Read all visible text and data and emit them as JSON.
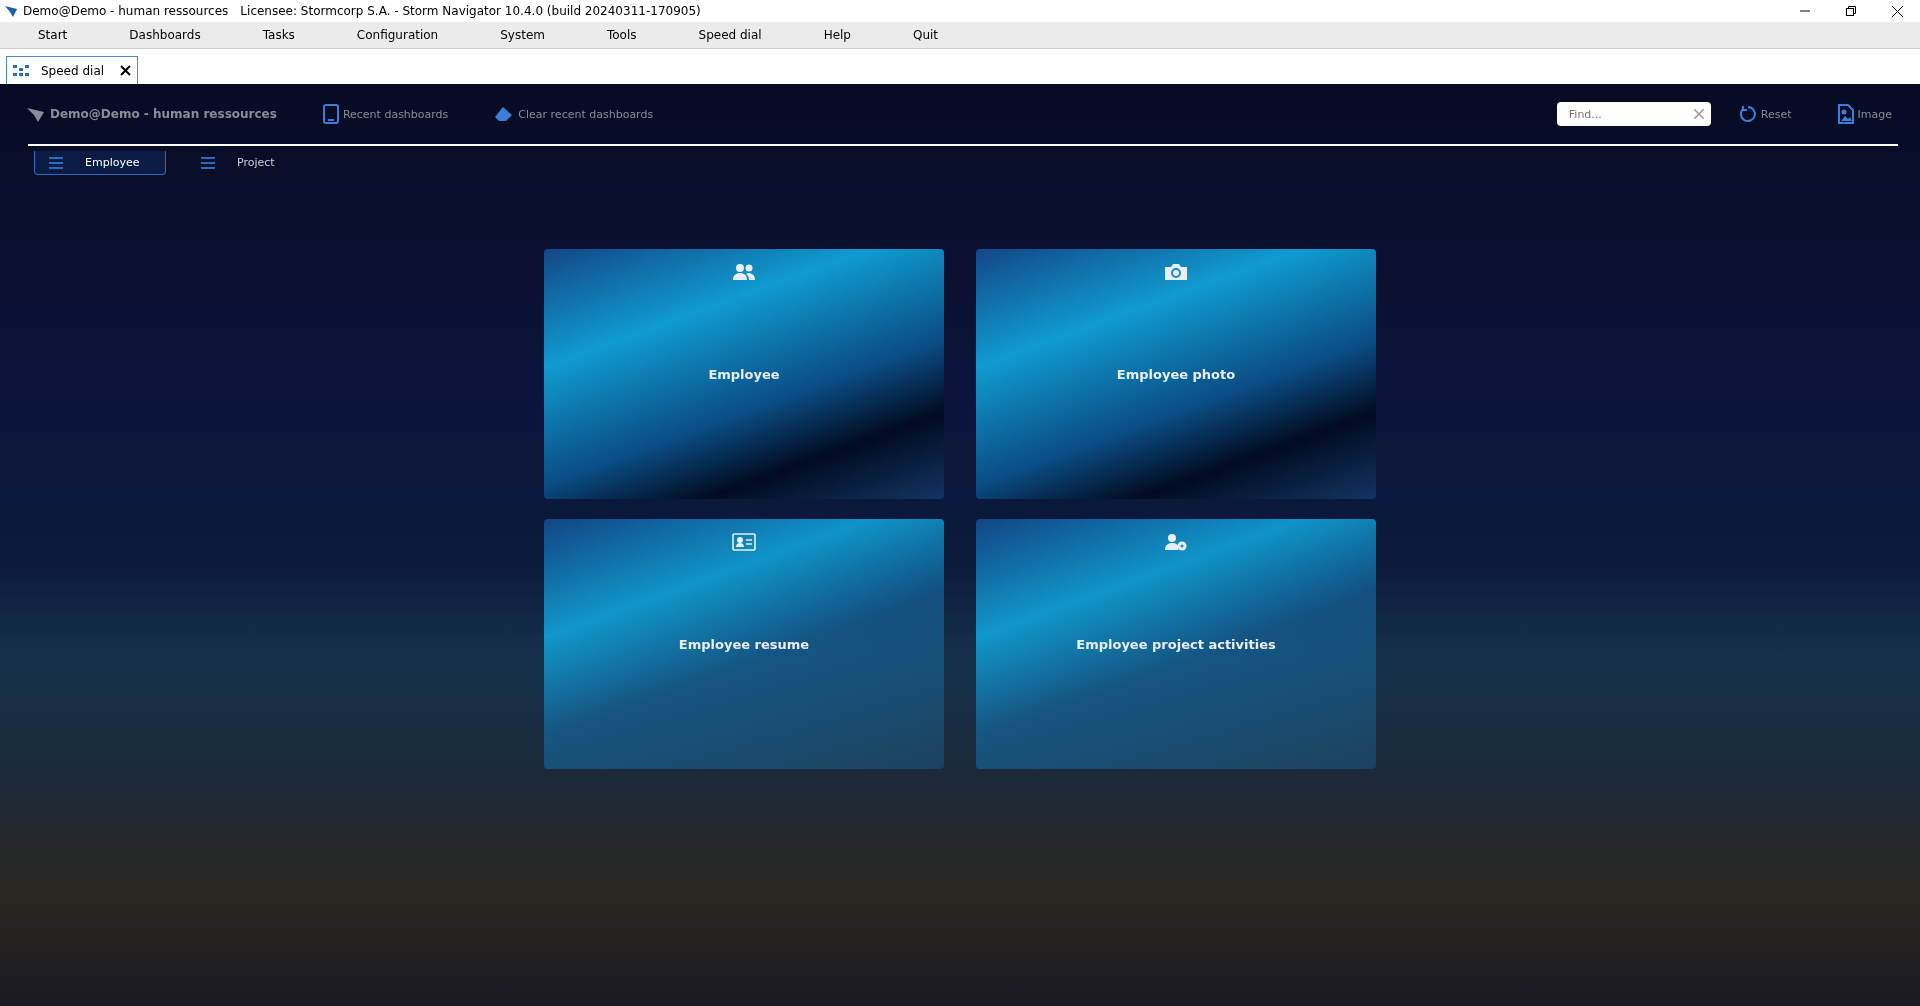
{
  "window": {
    "title": "Demo@Demo - human ressources",
    "licensee": "Licensee: Stormcorp S.A. -  Storm Navigator 10.4.0 (build 20240311-170905)"
  },
  "menu": [
    "Start",
    "Dashboards",
    "Tasks",
    "Configuration",
    "System",
    "Tools",
    "Speed dial",
    "Help",
    "Quit"
  ],
  "doc_tabs": [
    {
      "label": "Speed dial",
      "selected": true
    }
  ],
  "toolbar": {
    "user": "Demo@Demo - human ressources",
    "actions": [
      {
        "kind": "recent",
        "label": "Recent dashboards"
      },
      {
        "kind": "clear",
        "label": "Clear recent dashboards"
      }
    ],
    "search": {
      "placeholder": "Find..."
    },
    "right_actions": [
      {
        "kind": "reset",
        "label": "Reset"
      },
      {
        "kind": "image",
        "label": "Image"
      }
    ]
  },
  "tabs": [
    {
      "label": "Employee",
      "selected": true
    },
    {
      "label": "Project",
      "selected": false
    }
  ],
  "tiles": [
    {
      "kind": "people",
      "label": "Employee"
    },
    {
      "kind": "camera",
      "label": "Employee photo"
    },
    {
      "kind": "card",
      "label": "Employee resume"
    },
    {
      "kind": "usergear",
      "label": "Employee project activities"
    }
  ]
}
